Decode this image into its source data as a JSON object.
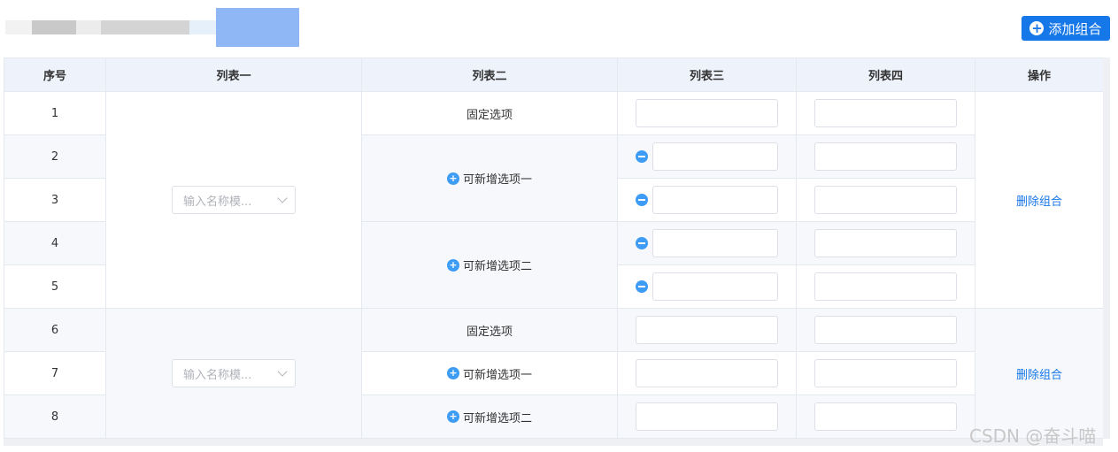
{
  "header": {
    "add_button_label": "添加组合"
  },
  "table": {
    "columns": [
      "序号",
      "列表一",
      "列表二",
      "列表三",
      "列表四",
      "操作"
    ],
    "row_numbers": [
      "1",
      "2",
      "3",
      "4",
      "5",
      "6",
      "7",
      "8"
    ],
    "group1": {
      "select_placeholder": "输入名称模...",
      "fixed_option": "固定选项",
      "add_option_1": "可新增选项一",
      "add_option_2": "可新增选项二",
      "delete_label": "删除组合"
    },
    "group2": {
      "select_placeholder": "输入名称模...",
      "fixed_option": "固定选项",
      "add_option_1": "可新增选项一",
      "add_option_2": "可新增选项二",
      "delete_label": "删除组合"
    }
  },
  "watermark": "CSDN @奋斗喵",
  "colors": {
    "primary": "#1677e8",
    "icon_blue": "#3d9cf5",
    "header_bg": "#edf2fb"
  }
}
